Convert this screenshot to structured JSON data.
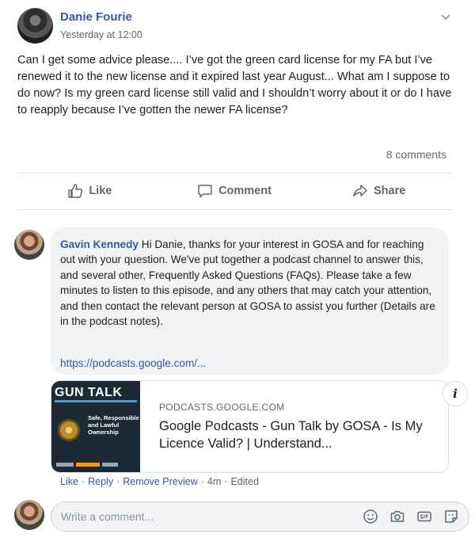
{
  "post": {
    "author": "Danie Fourie",
    "time": "Yesterday at 12:00",
    "text": "Can I get some advice please.... I’ve got the green card license for my FA but I’ve renewed it to the new license and it expired last year August... What am I suppose to do now? Is my green card license still valid and I shouldn’t worry about it or do I have to reapply because I’ve gotten the newer FA license?",
    "comments_count": "8 comments"
  },
  "actions": {
    "like": "Like",
    "comment": "Comment",
    "share": "Share"
  },
  "comment": {
    "author": "Gavin Kennedy",
    "text": " Hi Danie, thanks for your interest in GOSA and for reaching out with your question. We've put together a podcast channel to answer this, and several other, Frequently Asked Questions (FAQs). Please take a few minutes to listen to this episode, and any others that may catch your attention, and then contact the relevant person at GOSA to assist you further (Details are in the podcast notes).",
    "link": "https://podcasts.google.com/...",
    "preview": {
      "thumb_title": "GUN TALK",
      "thumb_subtitle": "Safe, Responsible and Lawful Ownership",
      "domain": "PODCASTS.GOOGLE.COM",
      "title": "Google Podcasts - Gun Talk by GOSA - Is My Licence Valid? | Understand..."
    },
    "meta": {
      "like": "Like",
      "reply": "Reply",
      "remove_preview": "Remove Preview",
      "time": "4m",
      "edited": "Edited"
    }
  },
  "write": {
    "placeholder": "Write a comment..."
  },
  "icons": {
    "chevron": "chevron-down-icon",
    "like": "thumbs-up-icon",
    "comment": "speech-bubble-icon",
    "share": "share-arrow-icon",
    "info": "info-icon",
    "emoji": "emoji-icon",
    "camera": "camera-icon",
    "gif": "gif-icon",
    "sticker": "sticker-icon"
  },
  "colors": {
    "link": "#385898",
    "secondary_text": "#606770",
    "bubble_bg": "#f2f3f5"
  }
}
